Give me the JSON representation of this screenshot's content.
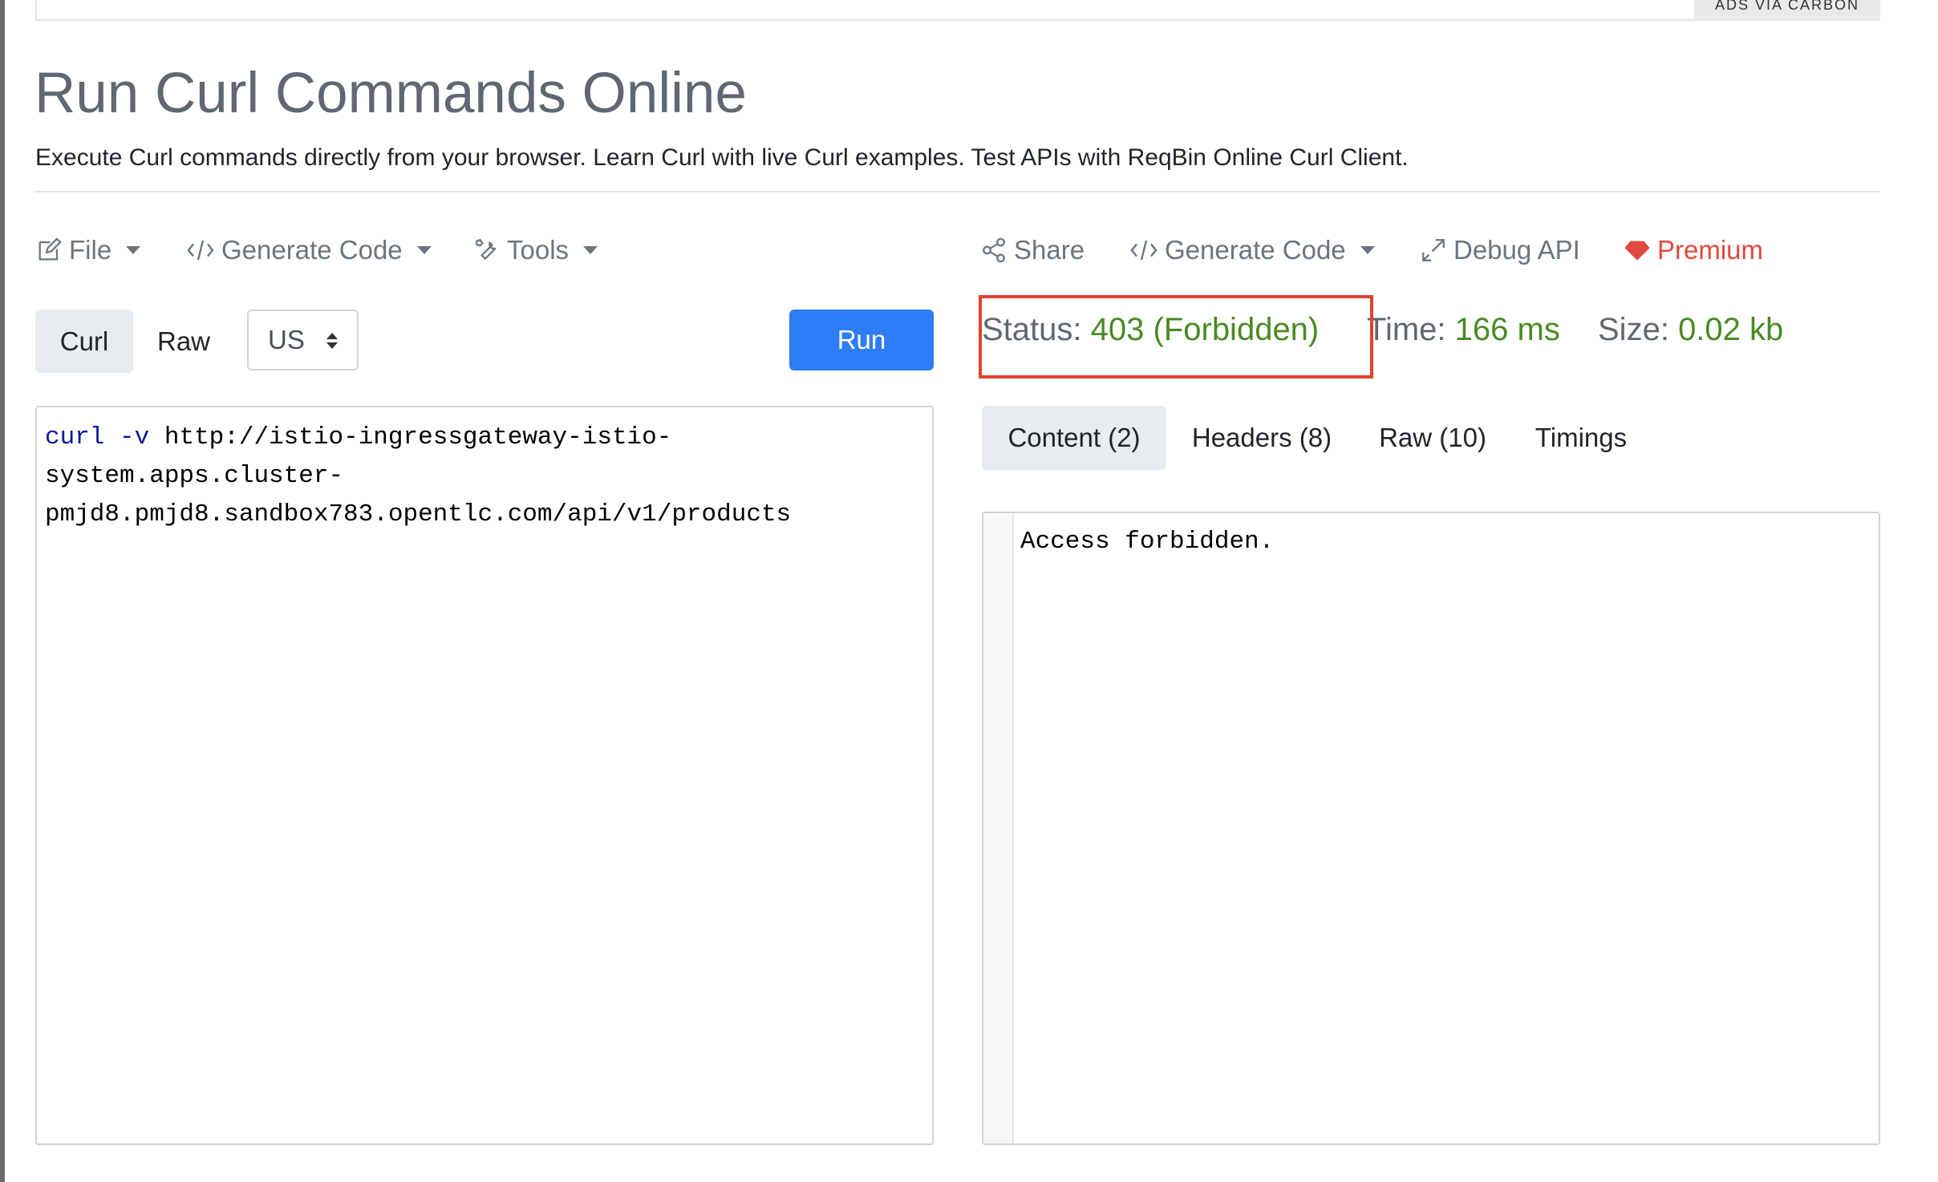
{
  "ad": {
    "label": "ADS VIA CARBON"
  },
  "header": {
    "title": "Run Curl Commands Online",
    "subtitle": "Execute Curl commands directly from your browser. Learn Curl with live Curl examples. Test APIs with ReqBin Online Curl Client."
  },
  "left_toolbar": {
    "file": "File",
    "generate_code": "Generate Code",
    "tools": "Tools"
  },
  "right_toolbar": {
    "share": "Share",
    "generate_code": "Generate Code",
    "debug_api": "Debug API",
    "premium": "Premium"
  },
  "request": {
    "tabs": [
      "Curl",
      "Raw"
    ],
    "region": "US",
    "run_label": "Run",
    "command_keyword": "curl",
    "command_flag": "-v",
    "command_url_lines": [
      "http://istio-ingressgateway-istio-",
      "system.apps.cluster-",
      "pmjd8.pmjd8.sandbox783.opentlc.com/api/v1/products"
    ]
  },
  "status": {
    "status_label": "Status:",
    "status_value": "403 (Forbidden)",
    "time_label": "Time:",
    "time_value": "166 ms",
    "size_label": "Size:",
    "size_value": "0.02 kb"
  },
  "response": {
    "tabs": [
      "Content (2)",
      "Headers (8)",
      "Raw (10)",
      "Timings"
    ],
    "content": "Access forbidden."
  },
  "colors": {
    "accent": "#2e7cf6",
    "success": "#4a8a24",
    "premium": "#e0493f",
    "highlight": "#e0432f"
  }
}
